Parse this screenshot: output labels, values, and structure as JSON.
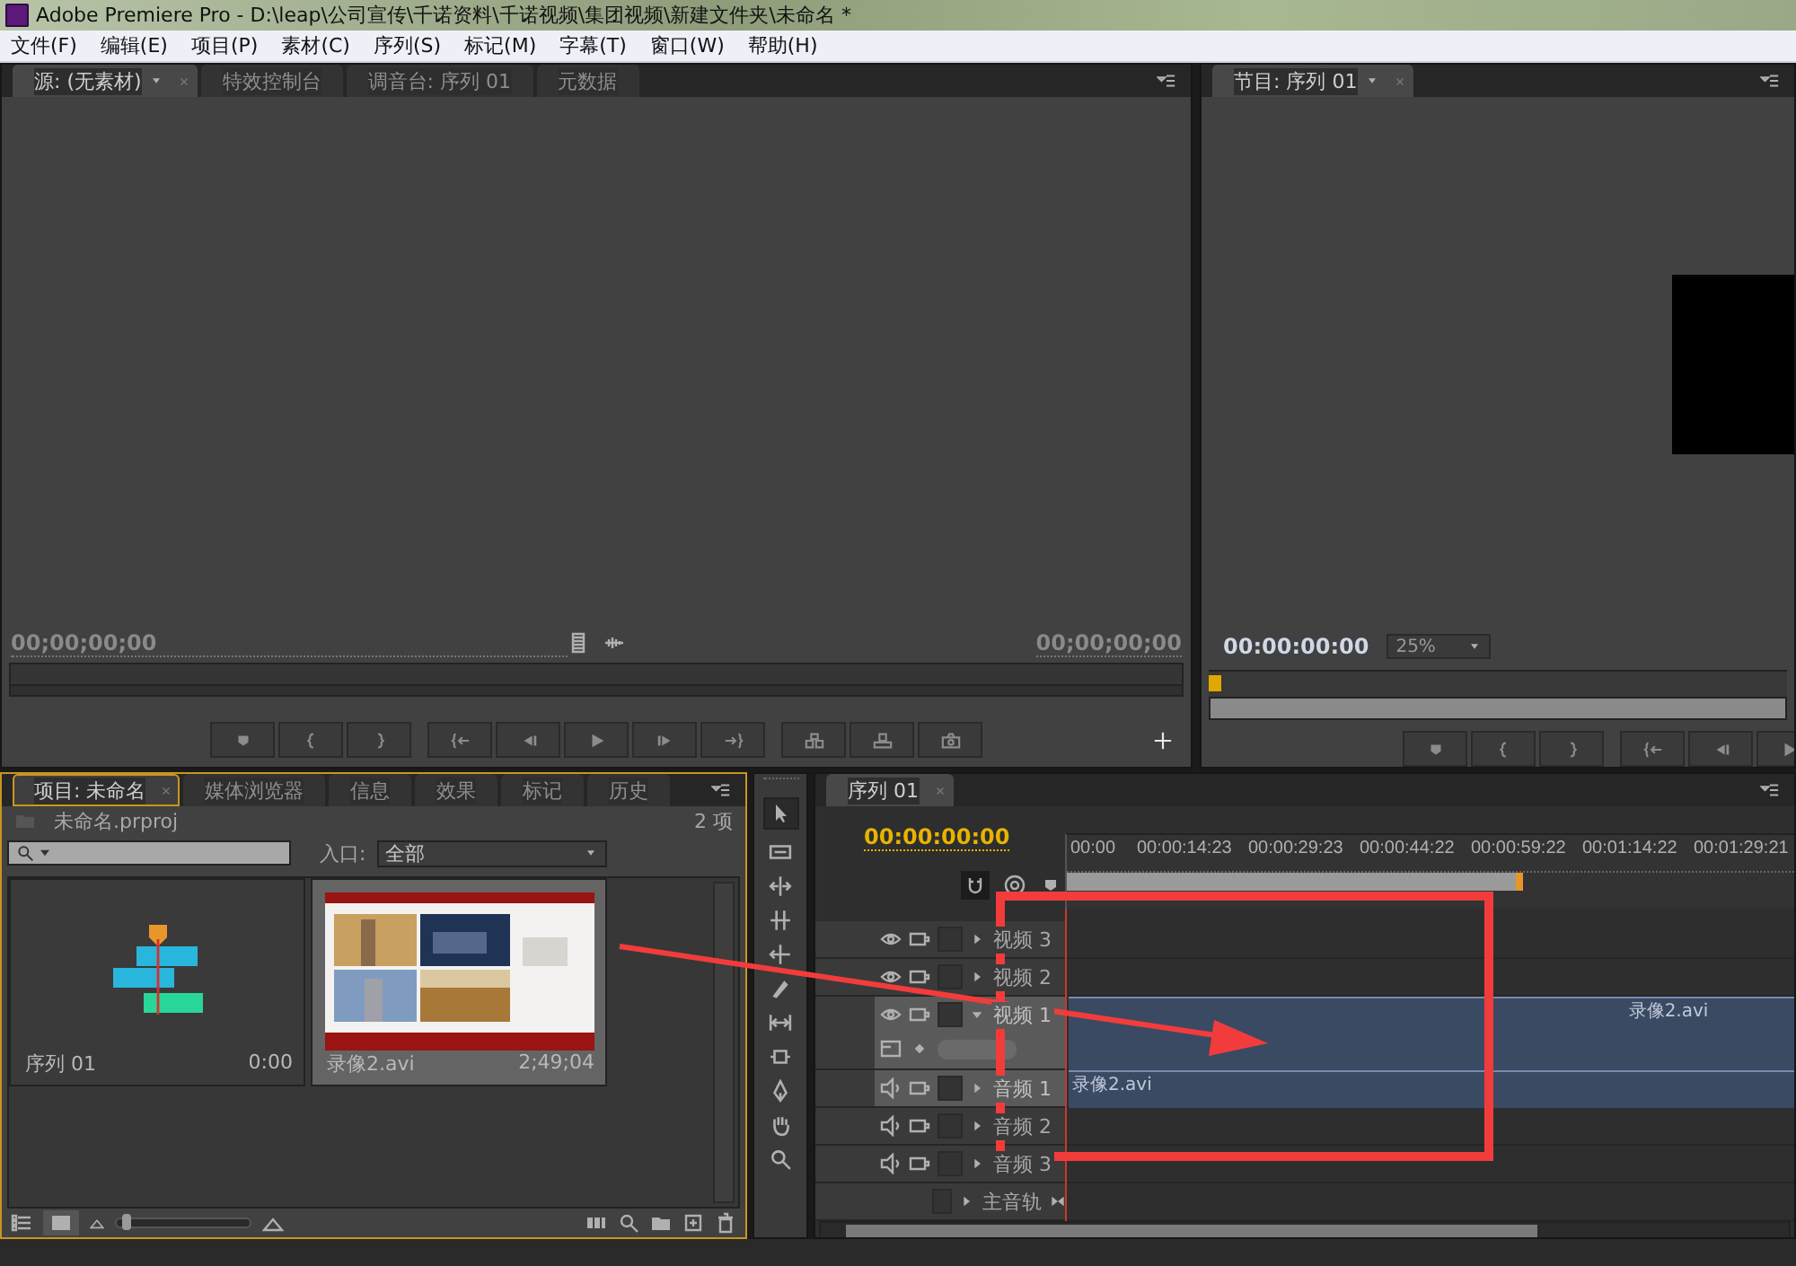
{
  "window": {
    "title": "Adobe Premiere Pro - D:\\leap\\公司宣传\\千诺资料\\千诺视频\\集团视频\\新建文件夹\\未命名 *"
  },
  "menu": [
    "文件(F)",
    "编辑(E)",
    "项目(P)",
    "素材(C)",
    "序列(S)",
    "标记(M)",
    "字幕(T)",
    "窗口(W)",
    "帮助(H)"
  ],
  "source_panel": {
    "tabs": [
      {
        "label": "源: (无素材)",
        "selected": true,
        "dropdown": true,
        "closable": true
      },
      {
        "label": "特效控制台",
        "selected": false,
        "dropdown": false,
        "closable": false
      },
      {
        "label": "调音台: 序列 01",
        "selected": false,
        "dropdown": false,
        "closable": false
      },
      {
        "label": "元数据",
        "selected": false,
        "dropdown": false,
        "closable": false
      }
    ],
    "timecode_in": "00;00;00;00",
    "timecode_out": "00;00;00;00"
  },
  "program_panel": {
    "tabs": [
      {
        "label": "节目: 序列 01",
        "selected": true,
        "dropdown": true,
        "closable": true
      }
    ],
    "timecode": "00:00:00:00",
    "zoom": "25%"
  },
  "project_panel": {
    "tabs": [
      {
        "label": "项目: 未命名",
        "selected": true,
        "closable": true
      },
      {
        "label": "媒体浏览器",
        "selected": false,
        "closable": false
      },
      {
        "label": "信息",
        "selected": false,
        "closable": false
      },
      {
        "label": "效果",
        "selected": false,
        "closable": false
      },
      {
        "label": "标记",
        "selected": false,
        "closable": false
      },
      {
        "label": "历史",
        "selected": false,
        "closable": false
      }
    ],
    "project_file": "未命名.prproj",
    "item_count": "2 项",
    "entry_label": "入口:",
    "entry_value": "全部",
    "items": [
      {
        "kind": "sequence",
        "name": "序列 01",
        "duration": "0:00",
        "selected": false
      },
      {
        "kind": "clip",
        "name": "录像2.avi",
        "duration": "2;49;04",
        "selected": true
      }
    ],
    "thumb_size": {
      "level": 0.04
    }
  },
  "timeline": {
    "tabs": [
      {
        "label": "序列 01",
        "selected": true,
        "closable": true
      }
    ],
    "timecode": "00:00:00:00",
    "ruler": [
      "00:00",
      "00:00:14:23",
      "00:00:29:23",
      "00:00:44:22",
      "00:00:59:22",
      "00:01:14:22",
      "00:01:29:21"
    ],
    "tracks": [
      {
        "kind": "video",
        "name": "视频 3",
        "targeted": false,
        "expanded": false
      },
      {
        "kind": "video",
        "name": "视频 2",
        "targeted": false,
        "expanded": false
      },
      {
        "kind": "video",
        "name": "视频 1",
        "targeted": true,
        "expanded": true,
        "clip": "录像2.avi"
      },
      {
        "kind": "audio",
        "name": "音频 1",
        "targeted": true,
        "expanded": false,
        "clip": "录像2.avi"
      },
      {
        "kind": "audio",
        "name": "音频 2",
        "targeted": false,
        "expanded": false
      },
      {
        "kind": "audio",
        "name": "音频 3",
        "targeted": false,
        "expanded": false
      },
      {
        "kind": "master",
        "name": "主音轨",
        "targeted": false,
        "expanded": false
      }
    ]
  }
}
